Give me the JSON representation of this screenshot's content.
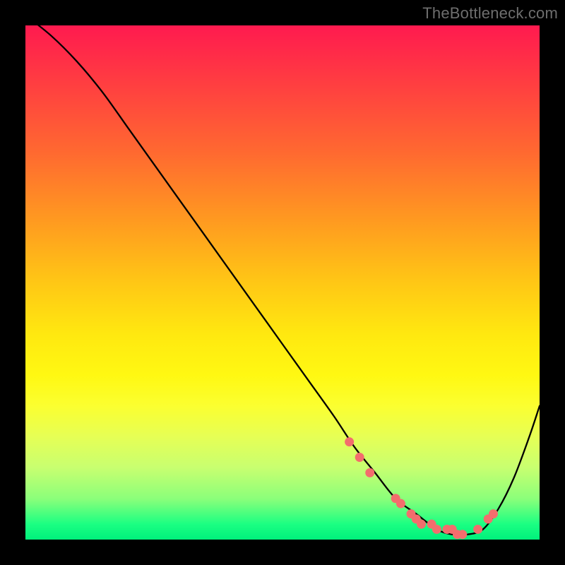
{
  "watermark": "TheBottleneck.com",
  "chart_data": {
    "type": "line",
    "title": "",
    "xlabel": "",
    "ylabel": "",
    "xlim": [
      0,
      100
    ],
    "ylim": [
      0,
      100
    ],
    "series": [
      {
        "name": "bottleneck-curve",
        "x": [
          0,
          5,
          10,
          15,
          20,
          25,
          30,
          35,
          40,
          45,
          50,
          55,
          60,
          64,
          68,
          72,
          76,
          80,
          83,
          86,
          89,
          92,
          95,
          98,
          100
        ],
        "values": [
          102,
          98,
          93,
          87,
          80,
          73,
          66,
          59,
          52,
          45,
          38,
          31,
          24,
          18,
          13,
          8,
          5,
          2,
          1,
          1,
          2,
          6,
          12,
          20,
          26
        ]
      }
    ],
    "markers": {
      "name": "highlight-dots",
      "color": "#f36d6d",
      "x": [
        63,
        65,
        67,
        72,
        73,
        75,
        76,
        77,
        79,
        80,
        82,
        83,
        84,
        85,
        88,
        90,
        91
      ],
      "values": [
        19,
        16,
        13,
        8,
        7,
        5,
        4,
        3,
        3,
        2,
        2,
        2,
        1,
        1,
        2,
        4,
        5
      ]
    }
  }
}
